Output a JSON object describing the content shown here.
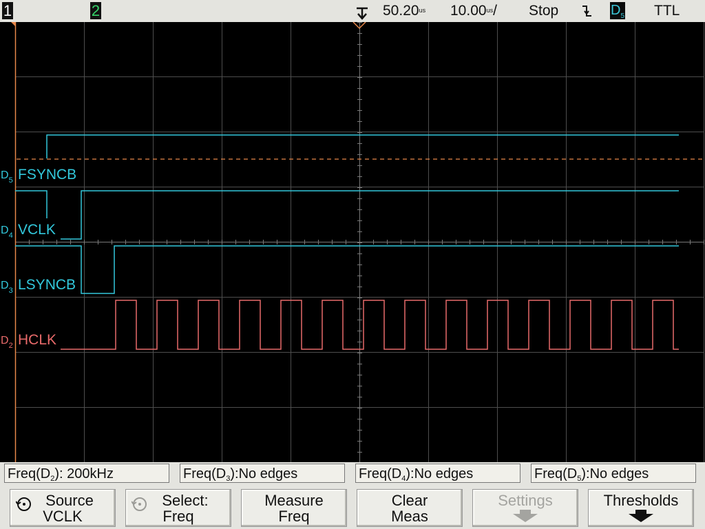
{
  "topbar": {
    "channel1": "1",
    "channel2": "2",
    "trigger_position": "50.20",
    "trigger_position_unit": "us",
    "timebase": "10.00",
    "timebase_unit": "us",
    "timebase_suffix": "/",
    "run_state": "Stop",
    "trigger_edge_icon": "falling-edge-icon",
    "trigger_source_letter": "D",
    "trigger_source_index": "5",
    "threshold": "TTL"
  },
  "channels": [
    {
      "id": "D",
      "index": "5",
      "name": "FSYNCB",
      "color": "#32c8dc"
    },
    {
      "id": "D",
      "index": "4",
      "name": "VCLK",
      "color": "#32c8dc"
    },
    {
      "id": "D",
      "index": "3",
      "name": "LSYNCB",
      "color": "#32c8dc"
    },
    {
      "id": "D",
      "index": "2",
      "name": "HCLK",
      "color": "#e86a6a"
    }
  ],
  "measurements": [
    {
      "prefix": "Freq(D",
      "index": "2",
      "suffix": "): 200kHz"
    },
    {
      "prefix": "Freq(D",
      "index": "3",
      "suffix": "):No edges"
    },
    {
      "prefix": "Freq(D",
      "index": "4",
      "suffix": "):No edges"
    },
    {
      "prefix": "Freq(D",
      "index": "5",
      "suffix": "):No edges"
    }
  ],
  "softkeys": [
    {
      "line1": "Source",
      "line2": "VCLK",
      "icon": "rotate-knob-icon",
      "enabled": true
    },
    {
      "line1": "Select:",
      "line2": "Freq",
      "icon": "rotate-knob-icon",
      "enabled": true
    },
    {
      "line1": "Measure",
      "line2": "Freq",
      "enabled": true
    },
    {
      "line1": "Clear",
      "line2": "Meas",
      "enabled": true
    },
    {
      "line1": "Settings",
      "icon": "down-arrow-icon",
      "enabled": false
    },
    {
      "line1": "Thresholds",
      "icon": "down-arrow-icon",
      "enabled": true
    }
  ],
  "colors": {
    "digital_channel": "#32c8dc",
    "hclk_channel": "#e86a6a",
    "grid": "#5a5a5a",
    "trigger_level": "#e8884a",
    "bar_background": "#e4e4df"
  }
}
